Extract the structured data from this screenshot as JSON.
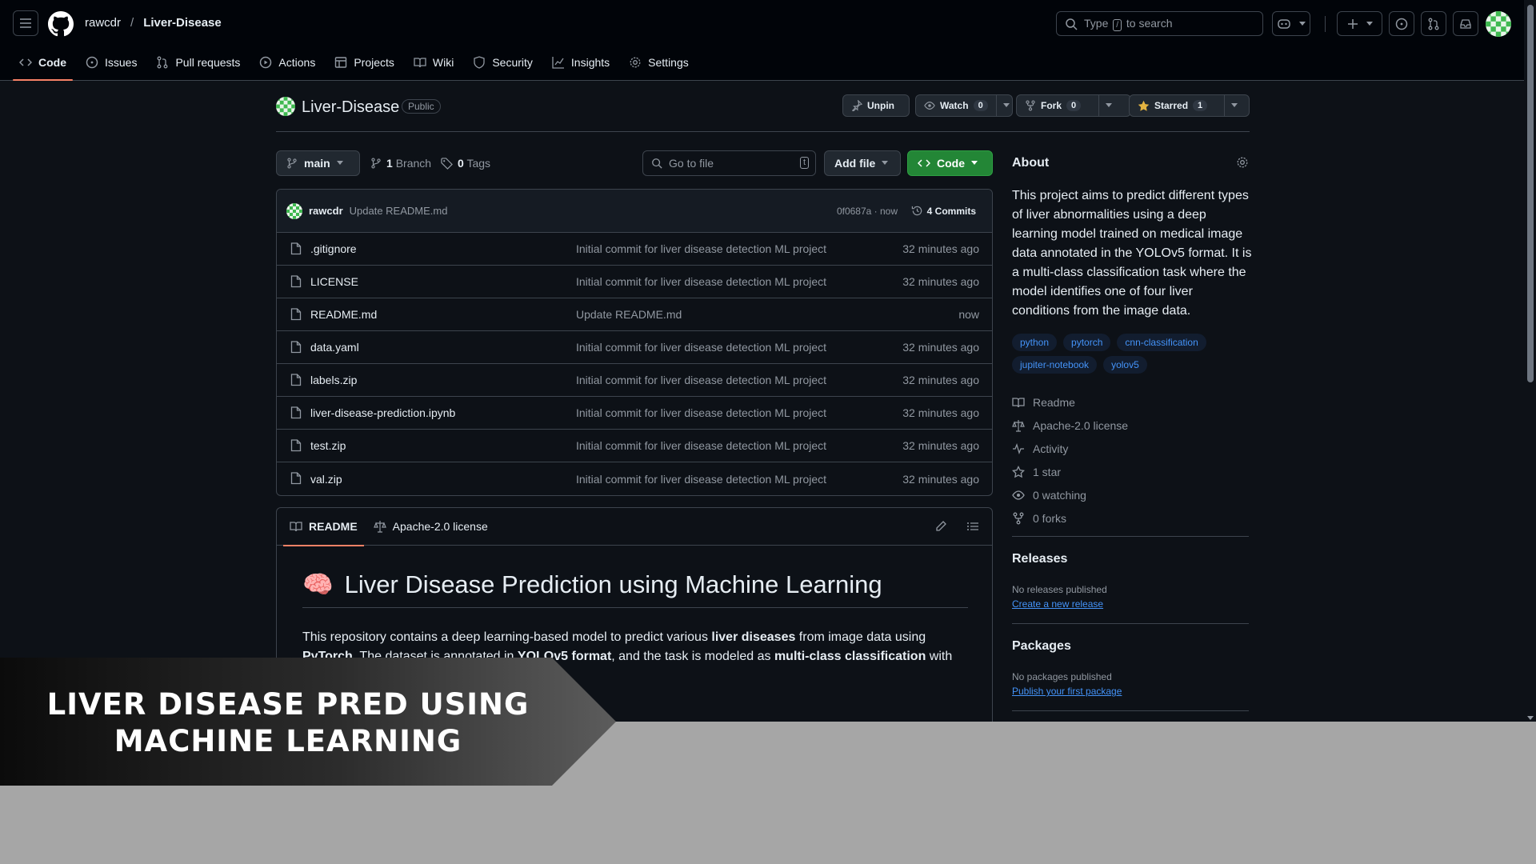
{
  "header": {
    "owner": "rawcdr",
    "separator": "/",
    "repo": "Liver-Disease",
    "search_prefix": "Type",
    "search_key": "/",
    "search_suffix": "to search"
  },
  "tabs": [
    "Code",
    "Issues",
    "Pull requests",
    "Actions",
    "Projects",
    "Wiki",
    "Security",
    "Insights",
    "Settings"
  ],
  "repo": {
    "name": "Liver-Disease",
    "visibility": "Public",
    "unpin": "Unpin",
    "watch": "Watch",
    "watch_count": "0",
    "fork": "Fork",
    "fork_count": "0",
    "starred": "Starred",
    "star_count": "1"
  },
  "filenav": {
    "branch": "main",
    "branches_count": "1",
    "branches_label": "Branch",
    "tags_count": "0",
    "tags_label": "Tags",
    "goto_placeholder": "Go to file",
    "goto_key": "t",
    "add_file": "Add file",
    "code": "Code"
  },
  "latest_commit": {
    "author": "rawcdr",
    "message": "Update README.md",
    "sha_time": "0f0687a · now",
    "commits": "4 Commits"
  },
  "files": [
    {
      "name": ".gitignore",
      "message": "Initial commit for liver disease detection ML project",
      "time": "32 minutes ago"
    },
    {
      "name": "LICENSE",
      "message": "Initial commit for liver disease detection ML project",
      "time": "32 minutes ago"
    },
    {
      "name": "README.md",
      "message": "Update README.md",
      "time": "now"
    },
    {
      "name": "data.yaml",
      "message": "Initial commit for liver disease detection ML project",
      "time": "32 minutes ago"
    },
    {
      "name": "labels.zip",
      "message": "Initial commit for liver disease detection ML project",
      "time": "32 minutes ago"
    },
    {
      "name": "liver-disease-prediction.ipynb",
      "message": "Initial commit for liver disease detection ML project",
      "time": "32 minutes ago"
    },
    {
      "name": "test.zip",
      "message": "Initial commit for liver disease detection ML project",
      "time": "32 minutes ago"
    },
    {
      "name": "val.zip",
      "message": "Initial commit for liver disease detection ML project",
      "time": "32 minutes ago"
    }
  ],
  "readme": {
    "tab_readme": "README",
    "tab_license": "Apache-2.0 license",
    "emoji": "🧠",
    "heading": "Liver Disease Prediction using Machine Learning",
    "p1": "This repository contains a deep learning-based model to predict various ",
    "p1_b1": "liver diseases",
    "p1_t2": " from image data using",
    "p2_b1": "PyTorch",
    "p2_t1": ". The dataset is annotated in ",
    "p2_b2": "YOLOv5 format",
    "p2_t2": ", and the task is modeled as ",
    "p2_b3": "multi-class classification",
    "p2_t3": " with four"
  },
  "about": {
    "title": "About",
    "description": "This project aims to predict different types of liver abnormalities using a deep learning model trained on medical image data annotated in the YOLOv5 format. It is a multi-class classification task where the model identifies one of four liver conditions from the image data.",
    "topics": [
      "python",
      "pytorch",
      "cnn-classification",
      "jupiter-notebook",
      "yolov5"
    ],
    "readme": "Readme",
    "license": "Apache-2.0 license",
    "activity": "Activity",
    "stars": "1 star",
    "watching": "0 watching",
    "forks": "0 forks"
  },
  "releases": {
    "title": "Releases",
    "none": "No releases published",
    "link": "Create a new release"
  },
  "packages": {
    "title": "Packages",
    "none": "No packages published",
    "link": "Publish your first package"
  },
  "banner": {
    "line1": "LIVER DISEASE PRED USING",
    "line2": "MACHINE LEARNING"
  },
  "colors": {
    "background": "#0d1117",
    "accent_tab": "#f78166",
    "link": "#4493f8",
    "green_button": "#238636",
    "star": "#e3b341"
  }
}
